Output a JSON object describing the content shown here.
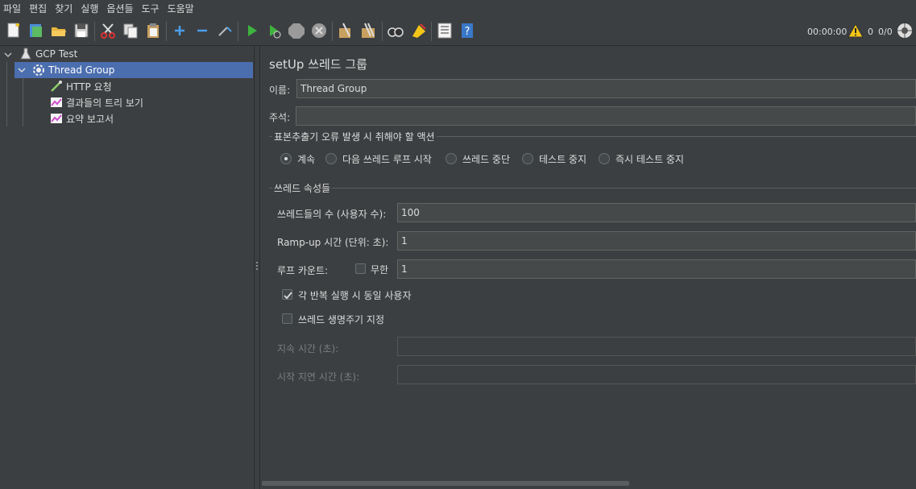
{
  "menu": [
    "파일",
    "편집",
    "찾기",
    "실행",
    "옵션들",
    "도구",
    "도움말"
  ],
  "toolbar": {
    "timer": "00:00:00",
    "warning_count": "0",
    "thread_ratio": "0/0",
    "colors": {
      "run": "#3fb33f",
      "stop": "#9a9a9a",
      "warn": "#f5c518"
    }
  },
  "tree": {
    "root": "GCP Test",
    "thread_group": "Thread Group",
    "children": [
      "HTTP 요청",
      "결과들의 트리 보기",
      "요약 보고서"
    ]
  },
  "panel": {
    "title": "setUp 쓰레드 그룹",
    "name_label": "이름:",
    "name_value": "Thread Group",
    "comment_label": "주석:",
    "comment_value": "",
    "sampler_error_legend": "표본추출기 오류 발생 시 취해야 할 액션",
    "radio_options": [
      "계속",
      "다음 쓰레드 루프 시작",
      "쓰레드 중단",
      "테스트 중지",
      "즉시 테스트 중지"
    ],
    "radio_selected": "계속",
    "thread_props_legend": "쓰레드 속성들",
    "threads_label": "쓰레드들의 수 (사용자 수):",
    "threads_value": "100",
    "rampup_label": "Ramp-up 시간 (단위: 초):",
    "rampup_value": "1",
    "loop_label": "루프 카운트:",
    "infinite_label": "무한",
    "infinite_checked": false,
    "loop_value": "1",
    "same_user_label": "각 반복 실행 시 동일 사용자",
    "same_user_checked": true,
    "lifetime_label": "쓰레드 생명주기 지정",
    "lifetime_checked": false,
    "duration_label": "지속 시간 (초):",
    "duration_value": "",
    "startup_delay_label": "시작 지연 시간 (초):",
    "startup_delay_value": ""
  }
}
